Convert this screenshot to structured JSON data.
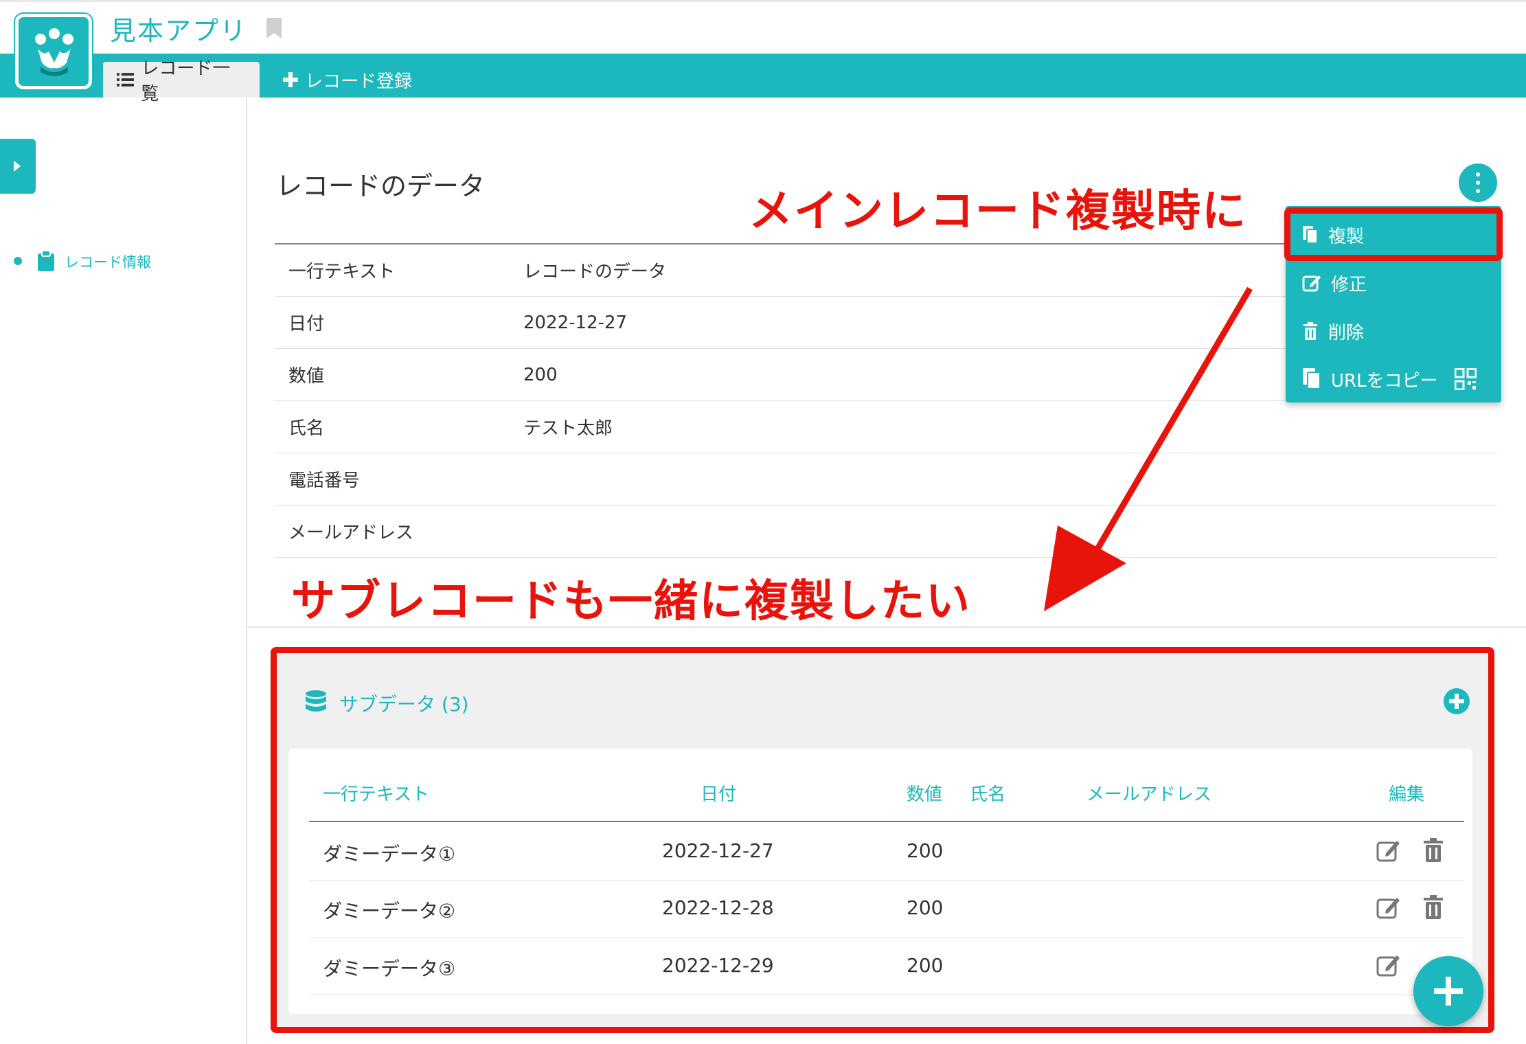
{
  "header": {
    "app_title": "見本アプリ",
    "tabs": [
      {
        "label": "レコード一覧",
        "active": true
      },
      {
        "label": "レコード登録",
        "active": false
      }
    ],
    "accent_color": "#1cb8bd"
  },
  "sidebar": {
    "items": [
      {
        "label": "レコード情報",
        "icon": "clipboard-icon"
      }
    ]
  },
  "record": {
    "title": "レコードのデータ",
    "fields": [
      {
        "label": "一行テキスト",
        "value": "レコードのデータ"
      },
      {
        "label": "日付",
        "value": "2022-12-27"
      },
      {
        "label": "数値",
        "value": "200"
      },
      {
        "label": "氏名",
        "value": "テスト太郎"
      },
      {
        "label": "電話番号",
        "value": ""
      },
      {
        "label": "メールアドレス",
        "value": ""
      }
    ]
  },
  "menu": {
    "items": [
      {
        "label": "複製",
        "icon": "copy-icon"
      },
      {
        "label": "修正",
        "icon": "edit-icon"
      },
      {
        "label": "削除",
        "icon": "trash-icon"
      },
      {
        "label": "URLをコピー",
        "icon": "copy-icon",
        "extra_icon": "qr-code-icon"
      }
    ]
  },
  "annotations": {
    "top": "メインレコード複製時に",
    "bottom": "サブレコードも一緒に複製したい",
    "color": "#e8140c"
  },
  "subdata": {
    "title": "サブデータ (3)",
    "columns": [
      "一行テキスト",
      "日付",
      "数値",
      "氏名",
      "メールアドレス",
      "編集"
    ],
    "rows": [
      {
        "text": "ダミーデータ①",
        "date": "2022-12-27",
        "number": "200"
      },
      {
        "text": "ダミーデータ②",
        "date": "2022-12-28",
        "number": "200"
      },
      {
        "text": "ダミーデータ③",
        "date": "2022-12-29",
        "number": "200"
      }
    ]
  }
}
